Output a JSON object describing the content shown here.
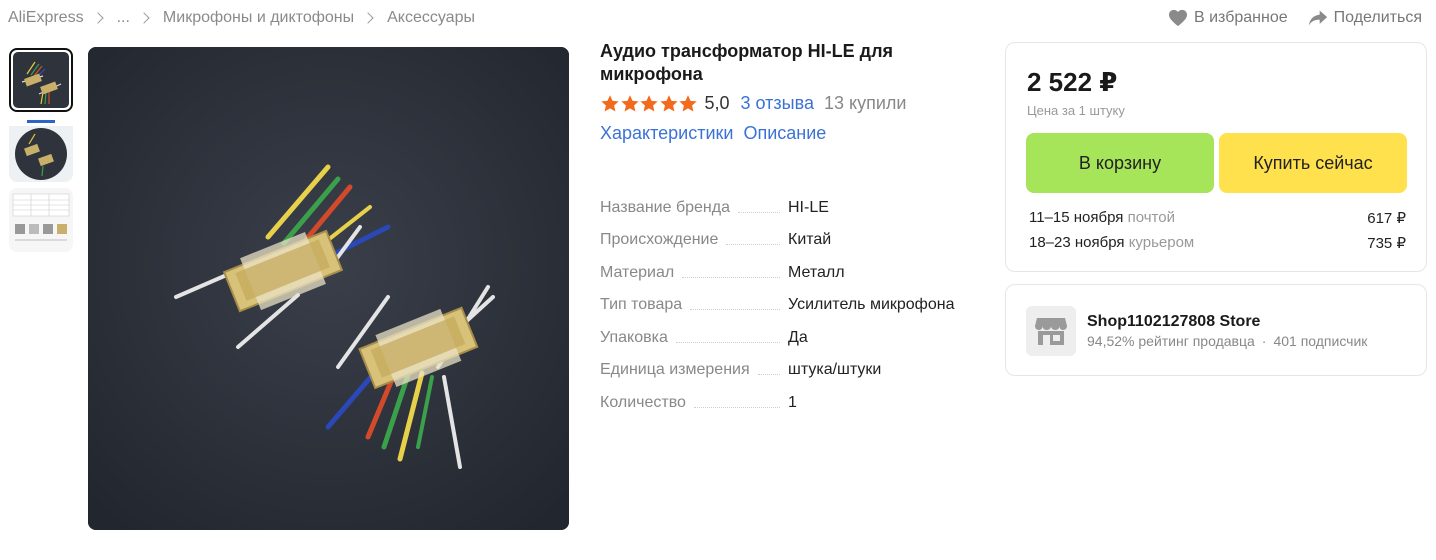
{
  "breadcrumb": [
    "AliExpress",
    "...",
    "Микрофоны и диктофоны",
    "Аксессуары"
  ],
  "top_actions": {
    "favorite": "В избранное",
    "share": "Поделиться"
  },
  "gallery": {
    "thumbnails": [
      "photo-transformers",
      "photo-transformers-alt",
      "photo-specs-sheet"
    ],
    "active_index": 0
  },
  "product": {
    "title": "Аудио трансформатор HI-LE для микрофона",
    "rating": "5,0",
    "stars": 5,
    "reviews": "3 отзыва",
    "bought": "13 купили",
    "links": [
      "Характеристики",
      "Описание"
    ]
  },
  "specs": [
    {
      "name": "Название бренда",
      "value": "HI-LE"
    },
    {
      "name": "Происхождение",
      "value": "Китай"
    },
    {
      "name": "Материал",
      "value": "Металл"
    },
    {
      "name": "Тип товара",
      "value": "Усилитель микрофона"
    },
    {
      "name": "Упаковка",
      "value": "Да"
    },
    {
      "name": "Единица измерения",
      "value": "штука/штуки"
    },
    {
      "name": "Количество",
      "value": "1"
    }
  ],
  "buy": {
    "price": "2 522 ₽",
    "price_note": "Цена за 1 штуку",
    "cart_label": "В корзину",
    "buy_now_label": "Купить сейчас",
    "shipping": [
      {
        "date": "11–15 ноября",
        "method": "почтой",
        "price": "617 ₽"
      },
      {
        "date": "18–23 ноября",
        "method": "курьером",
        "price": "735 ₽"
      }
    ]
  },
  "store": {
    "name": "Shop1102127808 Store",
    "rating": "94,52% рейтинг продавца",
    "separator": "·",
    "subscribers": "401 подписчик"
  },
  "colors": {
    "link": "#3b72d6",
    "star": "#f26b1d",
    "cart_button": "#a6e55a",
    "buy_button": "#ffe14d"
  }
}
